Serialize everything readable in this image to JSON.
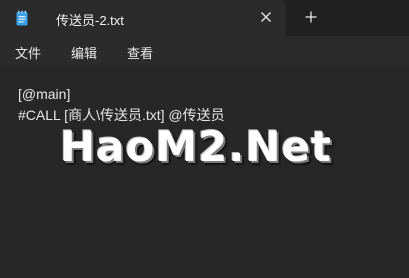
{
  "tab": {
    "title": "传送员-2.txt",
    "icon": "notepad-icon"
  },
  "menu": {
    "file": "文件",
    "edit": "编辑",
    "view": "查看"
  },
  "editor": {
    "lines": [
      "[@main]",
      "#CALL [商人\\传送员.txt] @传送员"
    ]
  },
  "watermark": {
    "text": "HaoM2.Net"
  },
  "colors": {
    "background": "#272727",
    "titlebar": "#202020",
    "icon_accent": "#3aa0e8"
  }
}
